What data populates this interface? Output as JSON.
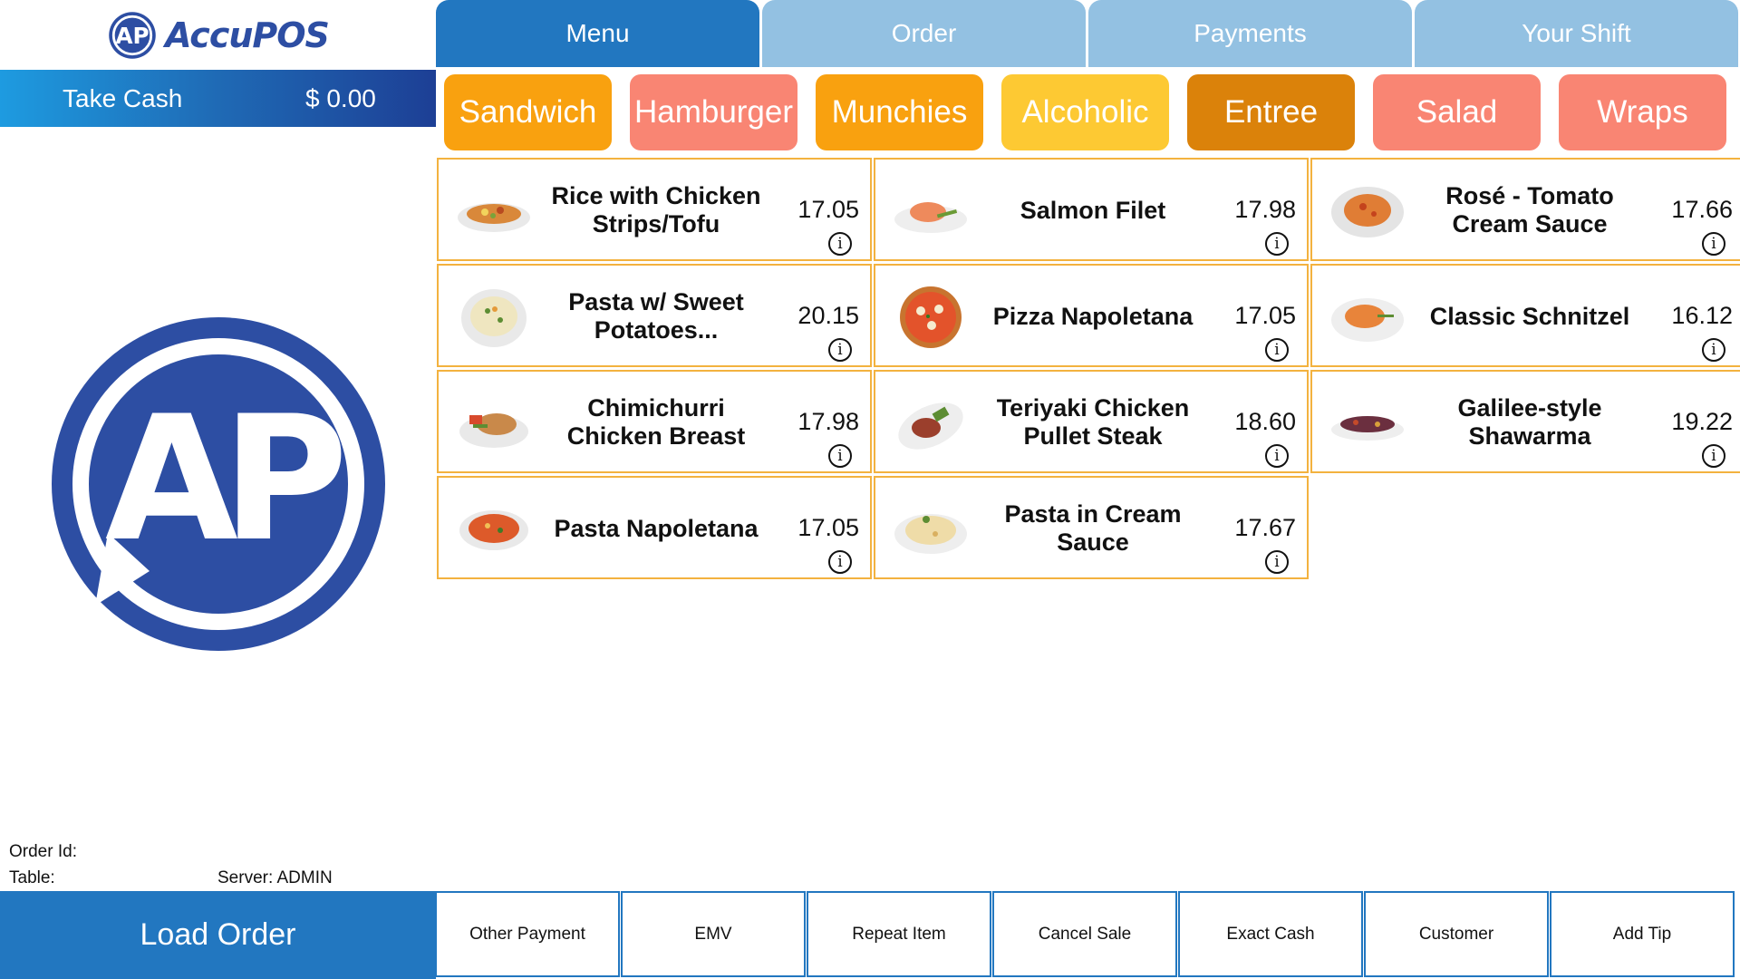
{
  "brand": {
    "name": "AccuPOS",
    "logo_mark": "AP"
  },
  "take_cash": {
    "label": "Take Cash",
    "amount": "$ 0.00"
  },
  "tabs": [
    {
      "label": "Menu",
      "active": true
    },
    {
      "label": "Order",
      "active": false
    },
    {
      "label": "Payments",
      "active": false
    },
    {
      "label": "Your Shift",
      "active": false
    }
  ],
  "categories": [
    {
      "label": "Sandwich",
      "color": "#f9a10f"
    },
    {
      "label": "Hamburger",
      "color": "#f98573"
    },
    {
      "label": "Munchies",
      "color": "#f9a10f"
    },
    {
      "label": "Alcoholic",
      "color": "#fdc933"
    },
    {
      "label": "Entree",
      "color": "#db820a"
    },
    {
      "label": "Salad",
      "color": "#f98573"
    },
    {
      "label": "Wraps",
      "color": "#f98573"
    }
  ],
  "menu_items": [
    {
      "name": "Rice with Chicken Strips/Tofu",
      "price": "17.05",
      "icon": "rice-chicken-dish-icon"
    },
    {
      "name": "Salmon Filet",
      "price": "17.98",
      "icon": "salmon-dish-icon"
    },
    {
      "name": "Rosé - Tomato Cream Sauce",
      "price": "17.66",
      "icon": "pasta-rose-dish-icon"
    },
    {
      "name": "Pasta w/ Sweet Potatoes...",
      "price": "20.15",
      "icon": "pasta-sweet-potato-dish-icon"
    },
    {
      "name": "Pizza Napoletana",
      "price": "17.05",
      "icon": "pizza-icon"
    },
    {
      "name": "Classic Schnitzel",
      "price": "16.12",
      "icon": "schnitzel-dish-icon"
    },
    {
      "name": "Chimichurri Chicken Breast",
      "price": "17.98",
      "icon": "chicken-breast-dish-icon"
    },
    {
      "name": "Teriyaki Chicken Pullet Steak",
      "price": "18.60",
      "icon": "teriyaki-steak-dish-icon"
    },
    {
      "name": "Galilee-style Shawarma",
      "price": "19.22",
      "icon": "shawarma-dish-icon"
    },
    {
      "name": "Pasta Napoletana",
      "price": "17.05",
      "icon": "pasta-napoletana-dish-icon"
    },
    {
      "name": "Pasta in Cream Sauce",
      "price": "17.67",
      "icon": "pasta-cream-dish-icon"
    }
  ],
  "order_info": {
    "order_id_label": "Order Id:",
    "table_label": "Table:",
    "server_label": "Server: ADMIN"
  },
  "load_order_label": "Load Order",
  "actions": [
    "Other Payment",
    "EMV",
    "Repeat Item",
    "Cancel Sale",
    "Exact Cash",
    "Customer",
    "Add Tip"
  ],
  "colors": {
    "primary_blue": "#2277c0",
    "tab_inactive": "#93c1e2",
    "card_border": "#f3b23f",
    "logo_blue": "#2d4ea3"
  }
}
